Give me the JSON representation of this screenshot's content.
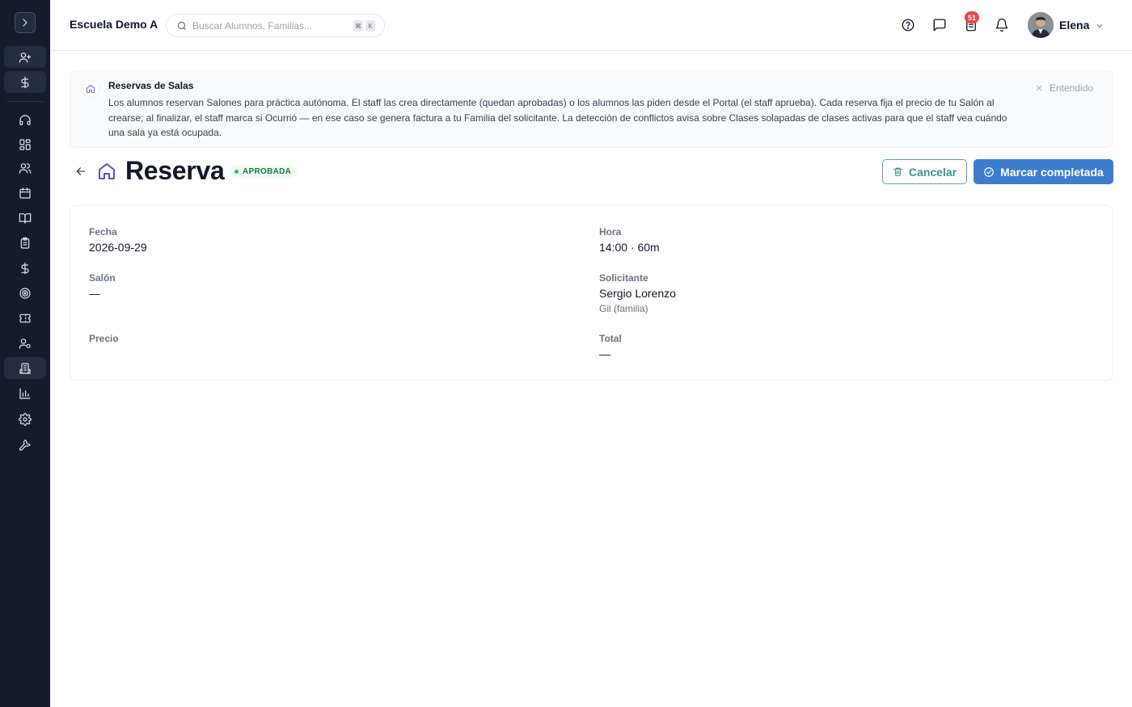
{
  "sidebar": {
    "toggle_icon": "chevron-right-icon",
    "items": [
      {
        "icon": "user-plus-icon"
      },
      {
        "icon": "dollar-icon"
      },
      {
        "icon": "headset-icon"
      },
      {
        "icon": "dashboard-grid-icon"
      },
      {
        "icon": "users-icon"
      },
      {
        "icon": "calendar-icon"
      },
      {
        "icon": "book-open-icon"
      },
      {
        "icon": "clipboard-list-icon"
      },
      {
        "icon": "dollar-icon"
      },
      {
        "icon": "target-icon"
      },
      {
        "icon": "ticket-icon"
      },
      {
        "icon": "user-cog-icon"
      },
      {
        "icon": "building-icon",
        "active": true
      },
      {
        "icon": "bar-chart-icon"
      },
      {
        "icon": "settings-icon"
      },
      {
        "icon": "wrench-icon"
      }
    ]
  },
  "topbar": {
    "school_name": "Escuela Demo A",
    "search_placeholder": "Buscar Alumnos, Familias...",
    "shortcut_key1": "⌘",
    "shortcut_key2": "K",
    "notification_count": "51",
    "user_name": "Elena"
  },
  "banner": {
    "title": "Reservas de Salas",
    "text": "Los alumnos reservan Salones para práctica autónoma. El staff las crea directamente (quedan aprobadas) o los alumnos las piden desde el Portal (el staff aprueba). Cada reserva fija el precio de tu Salón al crearse; al finalizar, el staff marca si Ocurrió — en ese caso se genera factura a tu Familia del solicitante. La detección de conflictos avisa sobre Clases solapadas de clases activas para que el staff vea cuándo una sala ya está ocupada.",
    "dismiss_label": "Entendido"
  },
  "page": {
    "title": "Reserva",
    "status": "APROBADA",
    "status_color": "#15803d",
    "cancel_label": "Cancelar",
    "complete_label": "Marcar completada",
    "accent_color": "#3d7dd0"
  },
  "details": {
    "fecha_label": "Fecha",
    "fecha_value": "2026-09-29",
    "hora_label": "Hora",
    "hora_value": "14:00 · 60m",
    "salon_label": "Salón",
    "salon_value": "—",
    "solicitante_label": "Solicitante",
    "solicitante_value": "Sergio Lorenzo",
    "solicitante_sub": "Gil (familia)",
    "precio_label": "Precio",
    "precio_value": "",
    "total_label": "Total",
    "total_value": "—"
  }
}
